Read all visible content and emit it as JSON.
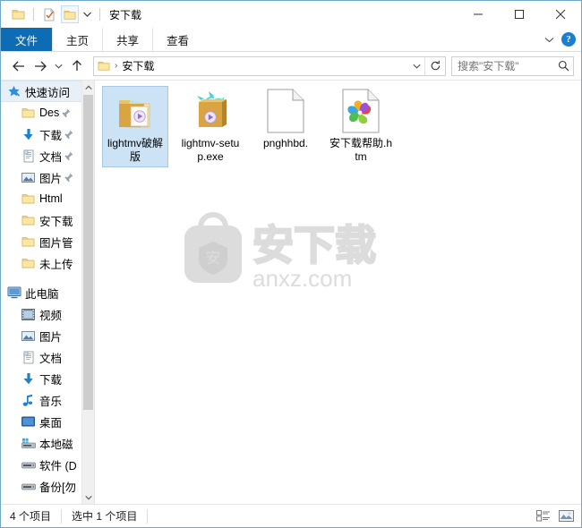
{
  "window": {
    "title": "安下载",
    "accent_color": "#0d6cb4",
    "selection_color": "#cce3f5",
    "border_color": "#6fa8c9"
  },
  "quick_access_toolbar": {
    "folder_icon": "folder-icon",
    "properties_icon": "properties-icon",
    "new_folder_icon": "new-folder-icon",
    "customize_icon": "chevron-down-icon"
  },
  "window_controls": {
    "minimize": "minimize-icon",
    "maximize": "maximize-icon",
    "close": "close-icon"
  },
  "ribbon": {
    "tabs": [
      {
        "label": "文件",
        "active": true
      },
      {
        "label": "主页",
        "active": false
      },
      {
        "label": "共享",
        "active": false
      },
      {
        "label": "查看",
        "active": false
      }
    ],
    "expand_icon": "chevron-down-icon",
    "help_label": "?"
  },
  "address_bar": {
    "back_icon": "back-arrow-icon",
    "forward_icon": "forward-arrow-icon",
    "recent_icon": "chevron-down-icon",
    "up_icon": "up-arrow-icon",
    "folder_icon": "folder-icon",
    "breadcrumb": "安下载",
    "breadcrumb_separator": "›",
    "dropdown_icon": "chevron-down-icon",
    "refresh_icon": "refresh-icon"
  },
  "search": {
    "placeholder": "搜索\"安下载\"",
    "value": "",
    "icon": "search-icon"
  },
  "sidebar": {
    "scroll": {
      "up_icon": "chevron-up-icon",
      "down_icon": "chevron-down-icon"
    },
    "groups": [
      {
        "name": "quick-access",
        "root": {
          "label": "快速访问",
          "icon": "star-pin-icon",
          "selected": true
        },
        "items": [
          {
            "label": "Des",
            "icon": "folder-icon",
            "pinned": true
          },
          {
            "label": "下载",
            "icon": "download-arrow-icon",
            "pinned": true
          },
          {
            "label": "文档",
            "icon": "document-icon",
            "pinned": true
          },
          {
            "label": "图片",
            "icon": "pictures-icon",
            "pinned": true
          },
          {
            "label": "Html",
            "icon": "folder-icon",
            "pinned": false
          },
          {
            "label": "安下载",
            "icon": "folder-icon",
            "pinned": false
          },
          {
            "label": "图片管",
            "icon": "folder-icon",
            "pinned": false
          },
          {
            "label": "未上传",
            "icon": "folder-icon",
            "pinned": false
          }
        ]
      },
      {
        "name": "this-pc",
        "root": {
          "label": "此电脑",
          "icon": "computer-icon",
          "selected": false
        },
        "items": [
          {
            "label": "视频",
            "icon": "videos-icon",
            "pinned": false
          },
          {
            "label": "图片",
            "icon": "pictures-icon",
            "pinned": false
          },
          {
            "label": "文档",
            "icon": "document-icon",
            "pinned": false
          },
          {
            "label": "下载",
            "icon": "download-arrow-icon",
            "pinned": false
          },
          {
            "label": "音乐",
            "icon": "music-note-icon",
            "pinned": false
          },
          {
            "label": "桌面",
            "icon": "desktop-icon",
            "pinned": false
          },
          {
            "label": "本地磁",
            "icon": "local-disk-icon",
            "pinned": false
          },
          {
            "label": "软件 (D",
            "icon": "drive-icon",
            "pinned": false
          },
          {
            "label": "备份[勿",
            "icon": "drive-icon",
            "pinned": false
          }
        ]
      }
    ]
  },
  "files": [
    {
      "name": "lightmv破解版",
      "icon": "open-folder-media-icon",
      "selected": true
    },
    {
      "name": "lightmv-setup.exe",
      "icon": "setup-box-icon",
      "selected": false
    },
    {
      "name": "pnghhbd.",
      "icon": "blank-page-icon",
      "selected": false
    },
    {
      "name": "安下载帮助.htm",
      "icon": "pinwheel-html-icon",
      "selected": false
    }
  ],
  "watermark": {
    "brand_cn": "安",
    "brand_url": "anxz.com"
  },
  "status_bar": {
    "item_count": "4 个项目",
    "selection": "选中 1 个项目",
    "view_details_icon": "details-view-icon",
    "view_thumbnails_icon": "large-icons-view-icon"
  }
}
